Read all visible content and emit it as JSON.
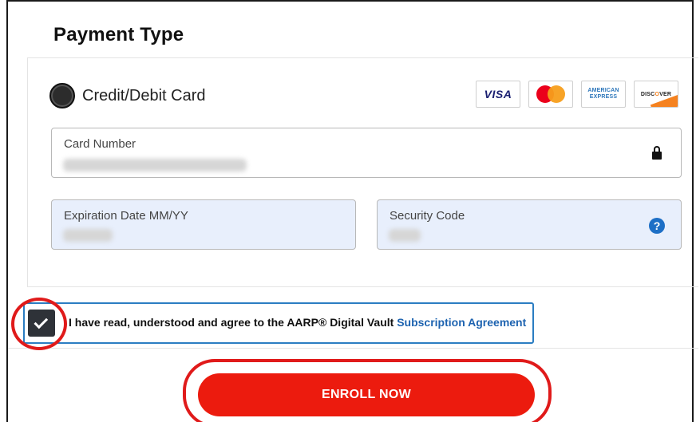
{
  "section": {
    "title": "Payment Type"
  },
  "payment_option": {
    "label": "Credit/Debit Card",
    "selected": true
  },
  "card_brands": [
    {
      "name": "visa",
      "label": "VISA"
    },
    {
      "name": "mastercard",
      "label": ""
    },
    {
      "name": "amex",
      "label_line1": "AMERICAN",
      "label_line2": "EXPRESS"
    },
    {
      "name": "discover",
      "label_pre": "DISC",
      "label_o": "O",
      "label_post": "VER"
    }
  ],
  "fields": {
    "card_number": {
      "label": "Card Number",
      "value_hidden": true,
      "icon": "lock-icon"
    },
    "expiration": {
      "label": "Expiration Date MM/YY",
      "value_hidden": true
    },
    "security_code": {
      "label": "Security Code",
      "value_hidden": true,
      "help_symbol": "?"
    }
  },
  "agreement": {
    "checked": true,
    "text": "I have read, understood and agree to the AARP® Digital Vault ",
    "link_text": "Subscription Agreement"
  },
  "enroll_button": {
    "label": "ENROLL NOW"
  },
  "colors": {
    "accent_red": "#ec1b0e",
    "annotation_red": "#e01a1a",
    "link_blue": "#1d63b0",
    "input_filled_bg": "#e8effc"
  }
}
